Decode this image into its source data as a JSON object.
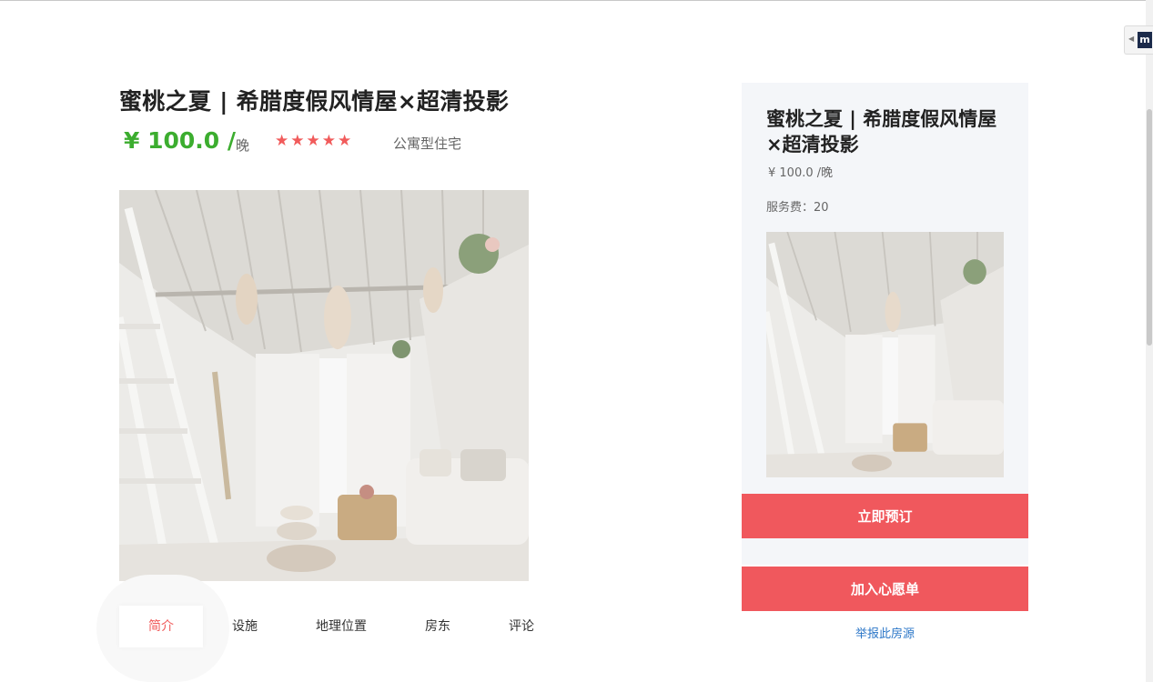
{
  "listing": {
    "title": "蜜桃之夏 | 希腊度假风情屋×超清投影",
    "price": "¥ 100.0 /",
    "per_night": "晚",
    "rating_stars": "★★★★★",
    "rating": 5,
    "property_type": "公寓型住宅"
  },
  "tabs": [
    {
      "label": "简介"
    },
    {
      "label": "设施"
    },
    {
      "label": "地理位置"
    },
    {
      "label": "房东"
    },
    {
      "label": "评论"
    }
  ],
  "sidebar": {
    "title": "蜜桃之夏 | 希腊度假风情屋×超清投影",
    "price": "¥ 100.0 /晚",
    "service_fee": "服务费：20",
    "book_label": "立即预订",
    "wishlist_label": "加入心愿单",
    "report_label": "举报此房源"
  },
  "colors": {
    "accent": "#f0585d",
    "price_green": "#3cad2f",
    "star": "#f15b5b",
    "link": "#2c77c8",
    "sidebar_bg": "#f4f6f9"
  },
  "extension": {
    "logo": "m",
    "icon": "collapse-arrow-icon"
  }
}
